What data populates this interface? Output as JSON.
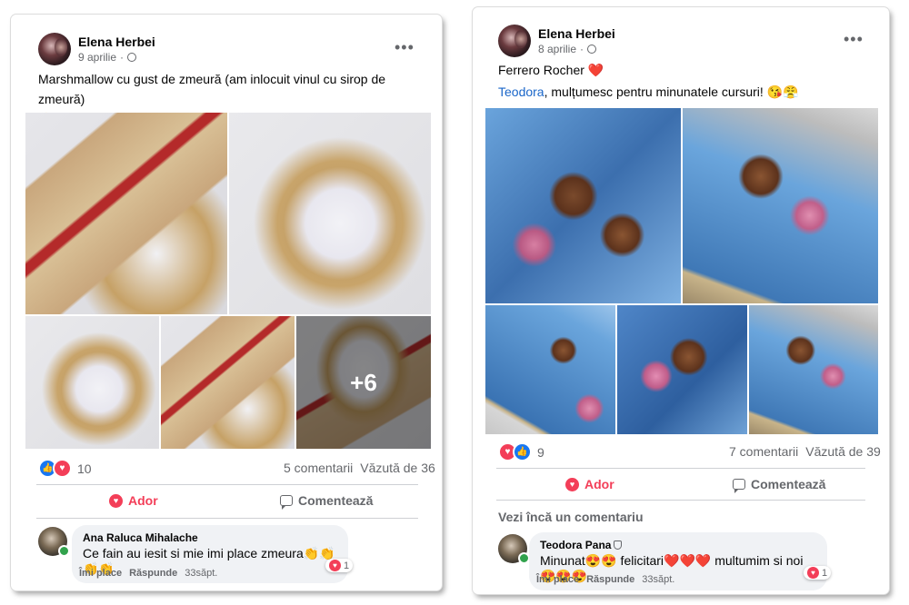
{
  "left_post": {
    "author": "Elena Herbei",
    "date": "9 aprilie",
    "more_label": "•••",
    "text_line1": "Marshmallow cu gust de zmeură (am inlocuit vinul cu sirop de zmeură)",
    "text_line2": "😌❤️",
    "photo_overlay": "+6",
    "reaction_count": "10",
    "comments_count": "5 comentarii",
    "views": "Văzută de 36",
    "like_label": "Ador",
    "comment_label": "Comentează",
    "comment": {
      "name": "Ana Raluca Mihalache",
      "text": "Ce fain au iesit si mie imi place zmeura👏👏👏👏",
      "reaction_count": "1",
      "reply_like": "Îmi place",
      "reply": "Răspunde",
      "time": "33săpt."
    }
  },
  "right_post": {
    "author": "Elena Herbei",
    "date": "8 aprilie",
    "more_label": "•••",
    "text_line1": "Ferrero Rocher ❤️",
    "mention": "Teodora",
    "text_line2": ", mulțumesc pentru minunatele cursuri! 😘😤",
    "reaction_count": "9",
    "comments_count": "7 comentarii",
    "views": "Văzută de 39",
    "like_label": "Ador",
    "comment_label": "Comentează",
    "view_more": "Vezi încă un comentariu",
    "comment": {
      "name": "Teodora Pana",
      "text": "Minunat😍😍 felicitari❤️❤️❤️ multumim si noi😍😍😍",
      "reaction_count": "1",
      "reply_like": "Îmi place",
      "reply": "Răspunde",
      "time": "33săpt."
    }
  },
  "icons": [
    "globe-icon",
    "more-icon",
    "like-reaction-icon",
    "love-reaction-icon",
    "heart-icon",
    "comment-icon",
    "shield-icon"
  ]
}
